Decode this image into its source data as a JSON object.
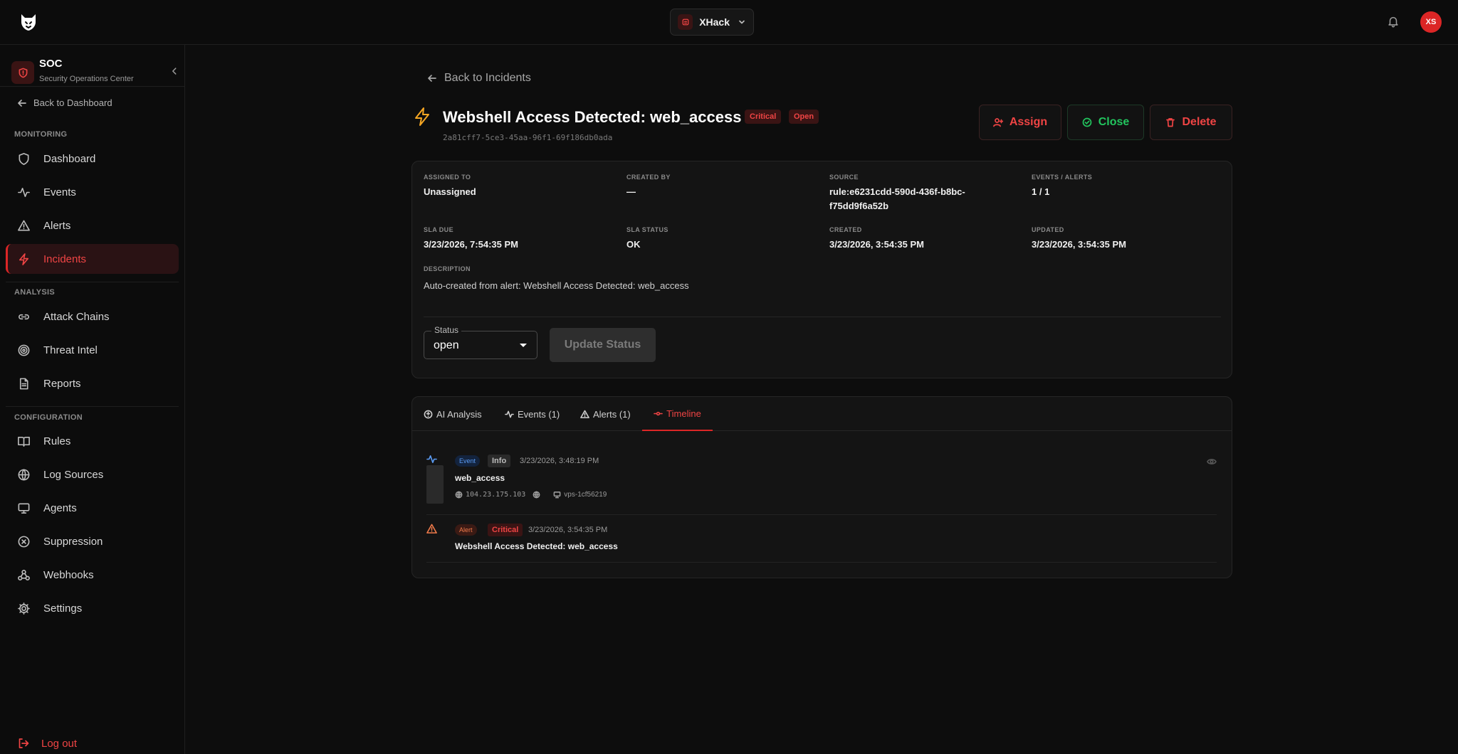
{
  "topbar": {
    "org_name": "XHack",
    "avatar_initials": "XS"
  },
  "sidebar": {
    "app_title": "SOC",
    "app_subtitle": "Security Operations Center",
    "back_label": "Back to Dashboard",
    "sections": {
      "monitoring": "MONITORING",
      "analysis": "ANALYSIS",
      "configuration": "CONFIGURATION"
    },
    "items": [
      {
        "label": "Dashboard",
        "icon": "shield-icon"
      },
      {
        "label": "Events",
        "icon": "activity-icon"
      },
      {
        "label": "Alerts",
        "icon": "warning-icon"
      },
      {
        "label": "Incidents",
        "icon": "bolt-icon",
        "active": true
      },
      {
        "label": "Attack Chains",
        "icon": "link-icon"
      },
      {
        "label": "Threat Intel",
        "icon": "target-icon"
      },
      {
        "label": "Reports",
        "icon": "document-icon"
      },
      {
        "label": "Rules",
        "icon": "book-icon"
      },
      {
        "label": "Log Sources",
        "icon": "globe-icon"
      },
      {
        "label": "Agents",
        "icon": "monitor-icon"
      },
      {
        "label": "Suppression",
        "icon": "block-icon"
      },
      {
        "label": "Webhooks",
        "icon": "webhook-icon"
      },
      {
        "label": "Settings",
        "icon": "gear-icon"
      }
    ],
    "logout_label": "Log out"
  },
  "incident": {
    "back_label": "Back to Incidents",
    "title": "Webshell Access Detected: web_access",
    "severity": "Critical",
    "status_badge": "Open",
    "id": "2a81cff7-5ce3-45aa-96f1-69f186db0ada",
    "actions": {
      "assign": "Assign",
      "close": "Close",
      "delete": "Delete"
    },
    "details": {
      "assigned_to": {
        "label": "ASSIGNED TO",
        "value": "Unassigned"
      },
      "created_by": {
        "label": "CREATED BY",
        "value": "—"
      },
      "source": {
        "label": "SOURCE",
        "value_line1": "rule:e6231cdd-590d-436f-b8bc-",
        "value_line2": "f75dd9f6a52b"
      },
      "events_alerts": {
        "label": "EVENTS / ALERTS",
        "value": "1 / 1"
      },
      "sla_due": {
        "label": "SLA DUE",
        "value": "3/23/2026, 7:54:35 PM"
      },
      "sla_status": {
        "label": "SLA STATUS",
        "value": "OK"
      },
      "created": {
        "label": "CREATED",
        "value": "3/23/2026, 3:54:35 PM"
      },
      "updated": {
        "label": "UPDATED",
        "value": "3/23/2026, 3:54:35 PM"
      },
      "description": {
        "label": "DESCRIPTION",
        "value": "Auto-created from alert: Webshell Access Detected: web_access"
      }
    },
    "status_field": {
      "legend": "Status",
      "value": "open"
    },
    "update_button": "Update Status"
  },
  "tabs": [
    {
      "label": "AI Analysis",
      "icon": "ai-icon"
    },
    {
      "label": "Events (1)",
      "icon": "activity-icon"
    },
    {
      "label": "Alerts (1)",
      "icon": "warning-icon"
    },
    {
      "label": "Timeline",
      "icon": "timeline-icon",
      "active": true
    }
  ],
  "timeline": [
    {
      "type": "Event",
      "severity": "Info",
      "time": "3/23/2026, 3:48:19 PM",
      "title": "web_access",
      "ip": "104.23.175.103",
      "host": "vps-1cf56219"
    },
    {
      "type": "Alert",
      "severity": "Critical",
      "time": "3/23/2026, 3:54:35 PM",
      "title": "Webshell Access Detected: web_access"
    }
  ],
  "colors": {
    "accent": "#dc2626",
    "success": "#22c55e",
    "warning": "#f5a623",
    "background": "#0d0d0d"
  }
}
